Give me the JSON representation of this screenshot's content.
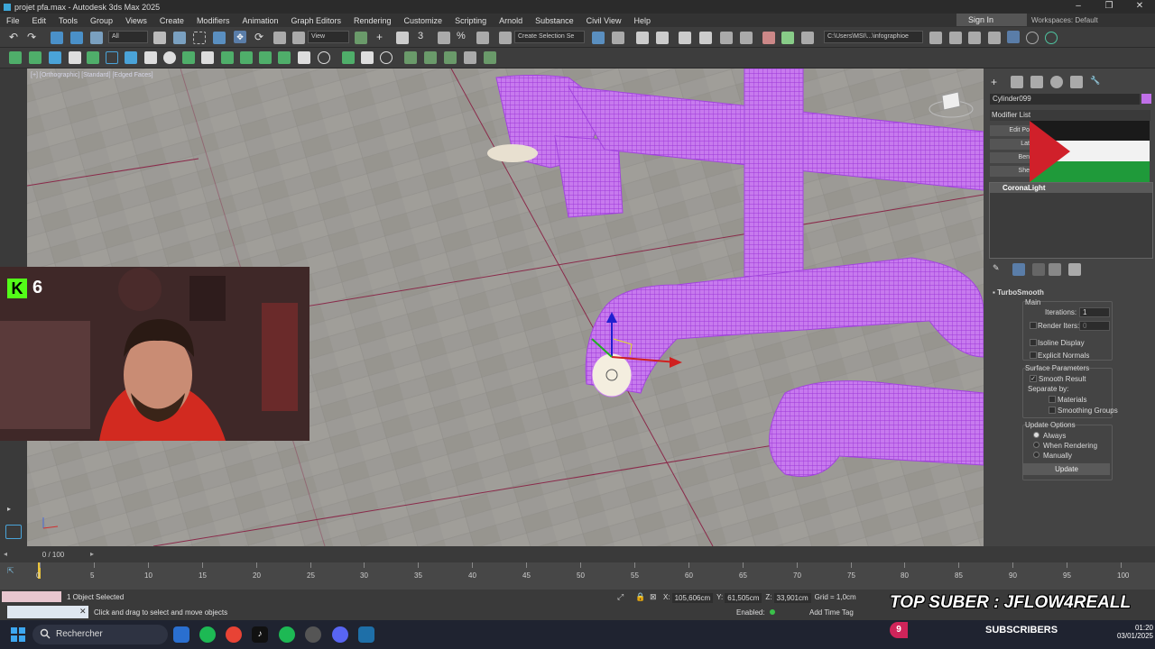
{
  "window": {
    "title": "projet pfa.max - Autodesk 3ds Max 2025",
    "controls": [
      "–",
      "❐",
      "✕"
    ]
  },
  "menu": [
    "File",
    "Edit",
    "Tools",
    "Group",
    "Views",
    "Create",
    "Modifiers",
    "Animation",
    "Graph Editors",
    "Rendering",
    "Customize",
    "Scripting",
    "Arnold",
    "Substance",
    "Civil View",
    "Help"
  ],
  "account": {
    "sign_in": "Sign In",
    "workspaces_label": "Workspaces:",
    "workspace": "Default"
  },
  "toolbar": {
    "filter": "All",
    "ref_coord": "View",
    "selection_set": "Create Selection Se",
    "path": "C:\\Users\\MSI\\...\\infographioe"
  },
  "viewport": {
    "label": "[+] [Orthographic] [Standard] [Edged Faces]",
    "background": "#9a9893",
    "wire_color": "#b24be6"
  },
  "stream": {
    "kick_icon": "K",
    "kick_viewers": "6"
  },
  "panel": {
    "object_name": "Cylinder099",
    "object_color": "#c070e8",
    "modifier_list": "Modifier List",
    "stack_buttons": [
      "Edit Po",
      "Lat",
      "Ben",
      "She"
    ],
    "stack_selected": "CoronaLight",
    "rollout_title": "TurboSmooth",
    "main_label": "Main",
    "iterations_label": "Iterations:",
    "iterations": "1",
    "render_iters_label": "Render Iters:",
    "render_iters": "0",
    "isoline": "Isoline Display",
    "explicit_normals": "Explicit Normals",
    "surface_params": "Surface Parameters",
    "smooth_result": "Smooth Result",
    "separate_by": "Separate by:",
    "materials": "Materials",
    "smoothing_groups": "Smoothing Groups",
    "update_options": "Update Options",
    "always": "Always",
    "when_rendering": "When Rendering",
    "manually": "Manually",
    "update_button": "Update"
  },
  "timeline": {
    "frame_label": "0 / 100",
    "ticks": [
      "0",
      "5",
      "10",
      "15",
      "20",
      "25",
      "30",
      "35",
      "40",
      "45",
      "50",
      "55",
      "60",
      "65",
      "70",
      "75",
      "80",
      "85",
      "90",
      "95",
      "100"
    ]
  },
  "status": {
    "selected": "1 Object Selected",
    "prompt": "Click and drag to select and move objects",
    "x_label": "X:",
    "x": "105,606cm",
    "y_label": "Y:",
    "y": "61,505cm",
    "z_label": "Z:",
    "z": "33,901cm",
    "grid": "Grid = 1,0cm",
    "enabled": "Enabled:",
    "add_time_tag": "Add Time Tag"
  },
  "overlay": {
    "top_suber": "TOP SUBER : JFLOW4REALL",
    "subscribers_count": "9",
    "subscribers_label": "SUBSCRIBERS"
  },
  "taskbar": {
    "search": "Rechercher",
    "time": "01:20",
    "date": "03/01/2025"
  }
}
